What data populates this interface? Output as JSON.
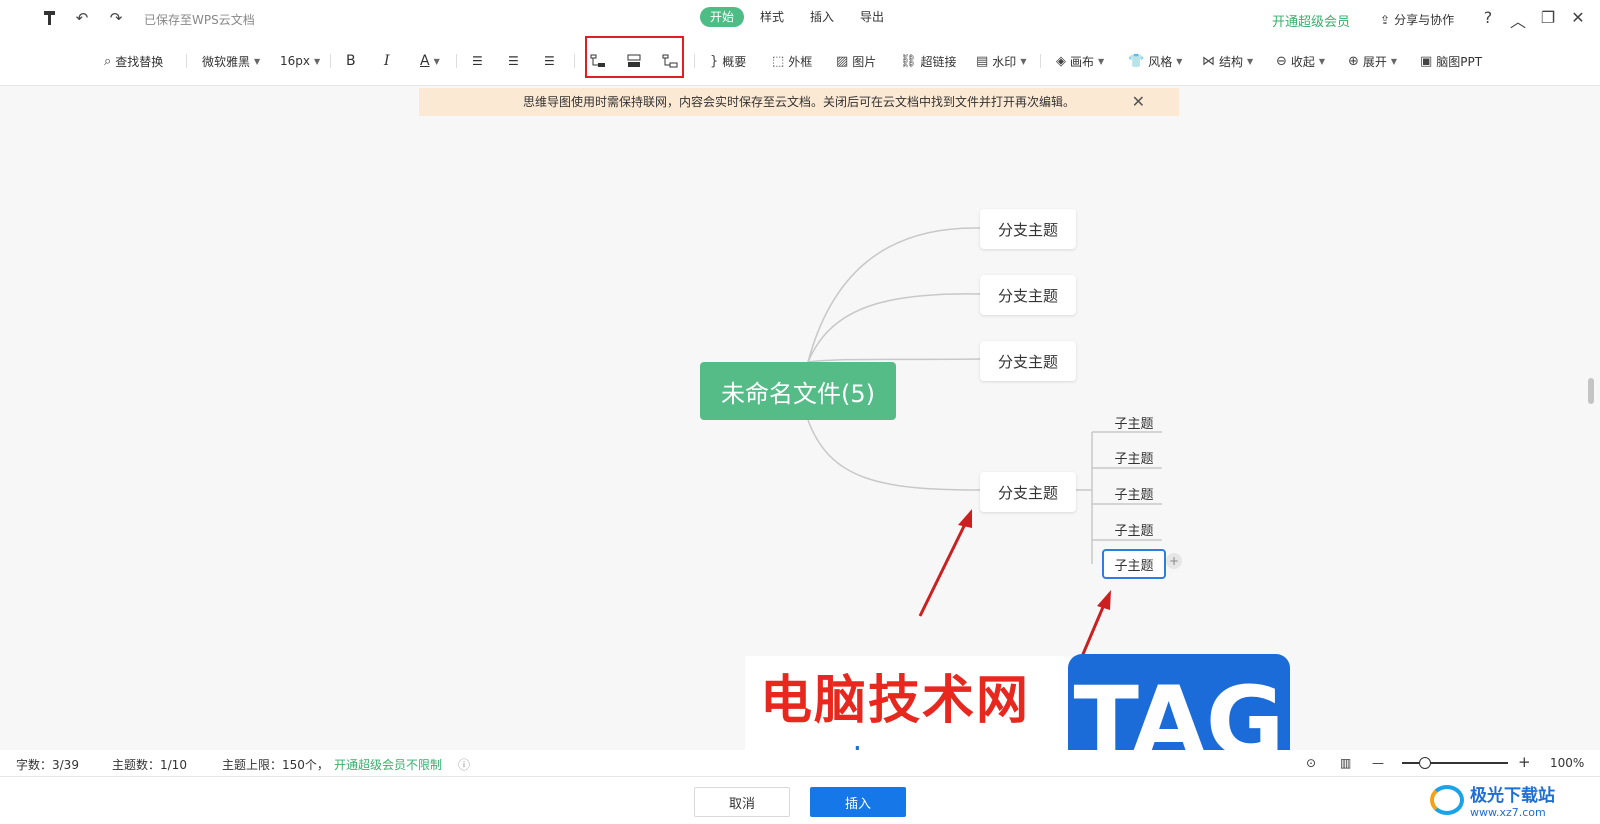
{
  "titlebar": {
    "save_status": "已保存至WPS云文档",
    "tabs": [
      "开始",
      "样式",
      "插入",
      "导出"
    ],
    "vip_link": "开通超级会员",
    "share": "分享与协作",
    "help": "?"
  },
  "toolbar": {
    "find_replace": "查找替换",
    "font": "微软雅黑",
    "font_size": "16px",
    "bold": "B",
    "italic": "I",
    "font_color": "A",
    "summary": "概要",
    "frame": "外框",
    "image": "图片",
    "hyperlink": "超链接",
    "watermark": "水印",
    "canvas": "画布",
    "style": "风格",
    "structure": "结构",
    "collapse": "收起",
    "expand": "展开",
    "mindmap_ppt": "脑图PPT"
  },
  "banner": {
    "message": "思维导图使用时需保持联网，内容会实时保存至云文档。关闭后可在云文档中找到文件并打开再次编辑。"
  },
  "mindmap": {
    "root": "未命名文件(5)",
    "branches": [
      "分支主题",
      "分支主题",
      "分支主题",
      "分支主题"
    ],
    "subtopics": [
      "子主题",
      "子主题",
      "子主题",
      "子主题",
      "子主题"
    ],
    "add": "+"
  },
  "watermark": {
    "site_name": "电脑技术网",
    "url": "www.tagxp.com",
    "tag": "TAG",
    "corner_name": "极光下载站",
    "corner_url": "www.xz7.com"
  },
  "statusbar": {
    "word_count": "字数：3/39",
    "topic_count": "主题数：1/10",
    "topic_limit": "主题上限：150个，",
    "vip_unlimited": "开通超级会员不限制",
    "zoom_minus": "—",
    "zoom_plus": "+",
    "zoom_level": "100%"
  },
  "footer": {
    "cancel": "取消",
    "insert": "插入"
  },
  "colors": {
    "accent_green": "#55bc88",
    "primary_blue": "#1677e8",
    "highlight_red": "#e02020",
    "banner_bg": "#fce9d4"
  }
}
